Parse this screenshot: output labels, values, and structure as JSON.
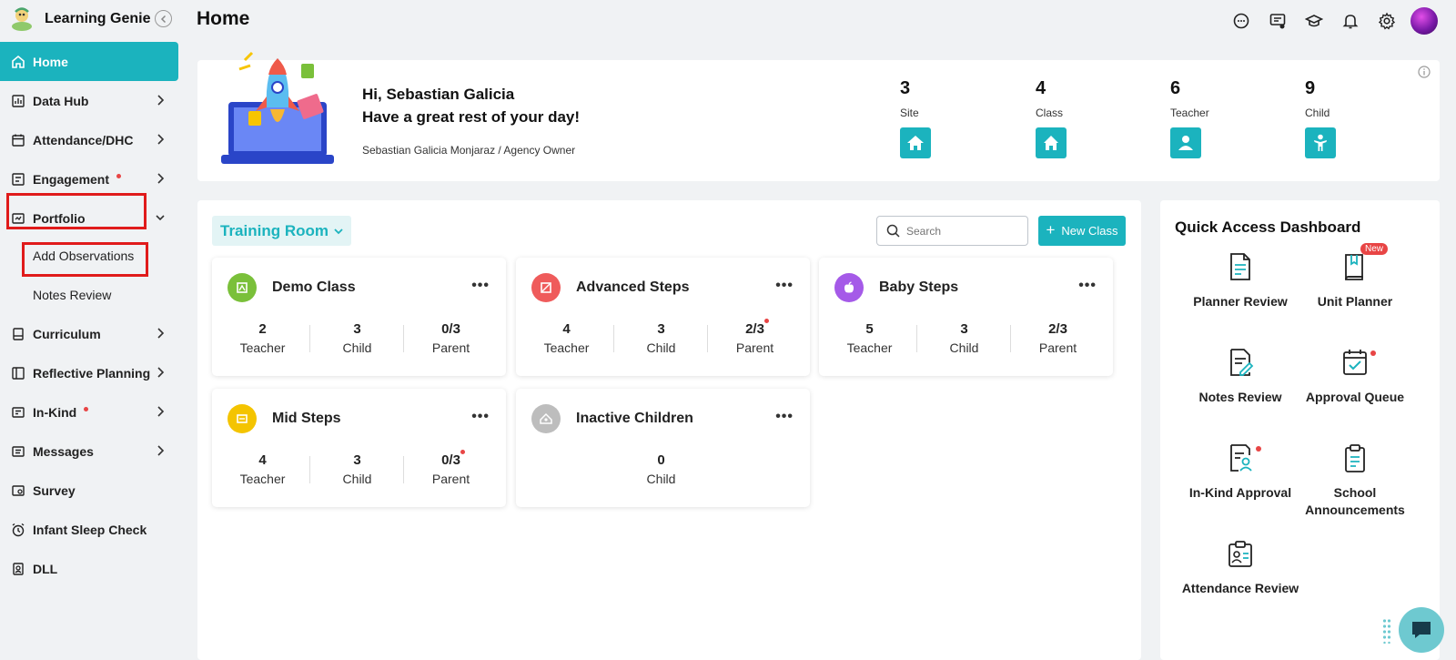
{
  "app": {
    "title": "Learning Genie"
  },
  "page": {
    "title": "Home"
  },
  "sidebar": {
    "items": [
      {
        "label": "Home"
      },
      {
        "label": "Data Hub"
      },
      {
        "label": "Attendance/DHC"
      },
      {
        "label": "Engagement"
      },
      {
        "label": "Portfolio"
      },
      {
        "label": "Curriculum"
      },
      {
        "label": "Reflective Planning"
      },
      {
        "label": "In-Kind"
      },
      {
        "label": "Messages"
      },
      {
        "label": "Survey"
      },
      {
        "label": "Infant Sleep Check"
      },
      {
        "label": "DLL"
      }
    ],
    "portfolio_sub": [
      {
        "label": "Add Observations"
      },
      {
        "label": "Notes Review"
      }
    ]
  },
  "welcome": {
    "greeting_line1": "Hi, Sebastian Galicia",
    "greeting_line2": "Have a great rest of your day!",
    "user_role": "Sebastian Galicia Monjaraz / Agency Owner",
    "stats": [
      {
        "value": "3",
        "label": "Site",
        "icon": "school-icon"
      },
      {
        "value": "4",
        "label": "Class",
        "icon": "home-icon"
      },
      {
        "value": "6",
        "label": "Teacher",
        "icon": "person-icon"
      },
      {
        "value": "9",
        "label": "Child",
        "icon": "child-icon"
      }
    ]
  },
  "classes": {
    "room": "Training Room",
    "search_placeholder": "Search",
    "new_class_label": "New Class",
    "cards": [
      {
        "name": "Demo Class",
        "teacher": "2",
        "child": "3",
        "parent": "0/3",
        "color": "#7ac03a"
      },
      {
        "name": "Advanced Steps",
        "teacher": "4",
        "child": "3",
        "parent": "2/3",
        "color": "#ef5b5b"
      },
      {
        "name": "Baby Steps",
        "teacher": "5",
        "child": "3",
        "parent": "2/3",
        "color": "#a55ae8"
      },
      {
        "name": "Mid Steps",
        "teacher": "4",
        "child": "3",
        "parent": "0/3",
        "color": "#f4c400"
      },
      {
        "name": "Inactive Children",
        "child": "0",
        "color": "#bdbdbd"
      }
    ],
    "labels": {
      "teacher": "Teacher",
      "child": "Child",
      "parent": "Parent"
    }
  },
  "quick_access": {
    "title": "Quick Access Dashboard",
    "new_badge": "New",
    "items": [
      {
        "label": "Planner Review"
      },
      {
        "label": "Unit Planner"
      },
      {
        "label": "Notes Review"
      },
      {
        "label": "Approval Queue"
      },
      {
        "label": "In-Kind Approval"
      },
      {
        "label": "School Announcements"
      },
      {
        "label": "Attendance Review"
      }
    ]
  },
  "colors": {
    "accent": "#1bb3be",
    "highlight": "#e01b1b",
    "alert_dot": "#e84545"
  }
}
